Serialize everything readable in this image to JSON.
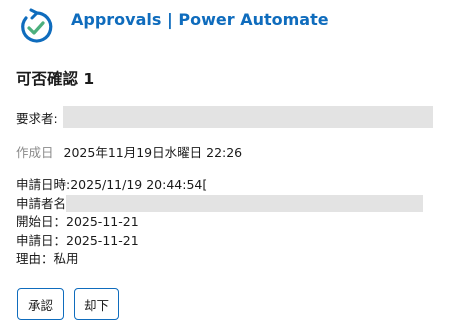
{
  "header": {
    "logo_icon": "power-automate-approvals-icon",
    "app_title": "Approvals | Power Automate",
    "accent_color": "#0f6cbd"
  },
  "card": {
    "title": "可否確認 1",
    "requester_label": "要求者:",
    "created_label": "作成日",
    "created_value": "2025年11月19日水曜日 22:26",
    "details": {
      "request_datetime": "申請日時:2025/11/19 20:44:54[",
      "applicant_label": "申請者名",
      "start_date": "開始日：2025-11-21",
      "application_date": "申請日：2025-11-21",
      "reason": "理由：私用"
    }
  },
  "actions": {
    "approve_label": "承認",
    "reject_label": "却下"
  }
}
